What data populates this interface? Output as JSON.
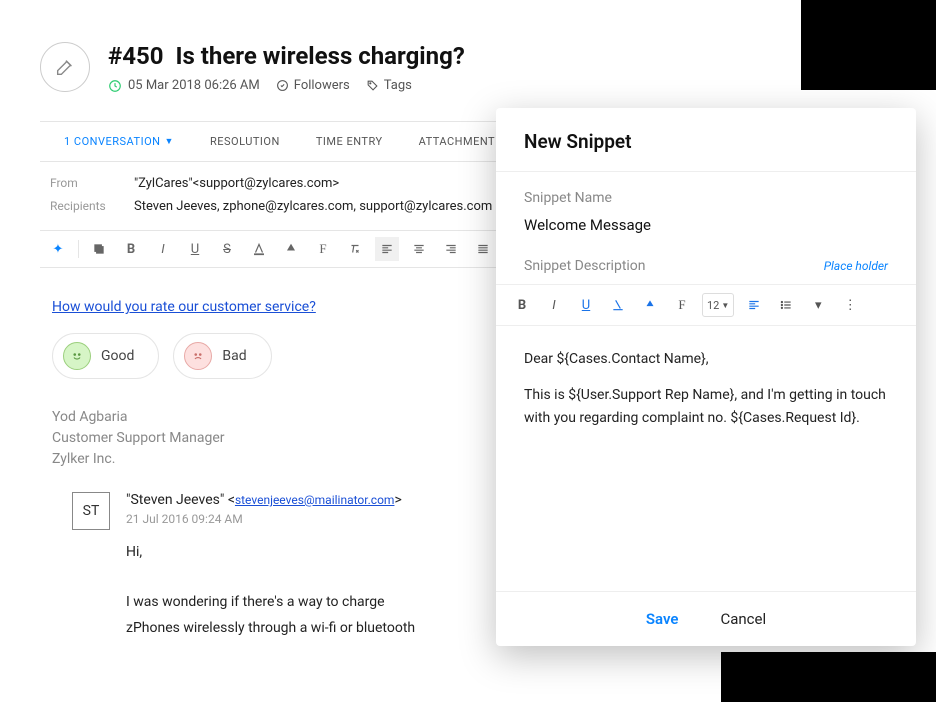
{
  "ticket": {
    "id": "#450",
    "title": "Is there wireless charging?",
    "timestamp": "05 Mar 2018 06:26 AM",
    "followers_label": "Followers",
    "tags_label": "Tags"
  },
  "tabs": {
    "conversation": "1 CONVERSATION",
    "resolution": "RESOLUTION",
    "time_entry": "TIME ENTRY",
    "attachment": "ATTACHMENT"
  },
  "fields": {
    "from_label": "From",
    "from_value": "\"ZylCares\"<support@zylcares.com>",
    "recipients_label": "Recipients",
    "recipients_value": "Steven Jeeves, zphone@zylcares.com, support@zylcares.com"
  },
  "survey": {
    "question": "How would you rate our customer service?",
    "good": "Good",
    "bad": "Bad"
  },
  "signature": {
    "name": "Yod Agbaria",
    "title": "Customer Support Manager",
    "company": "Zylker Inc."
  },
  "reply": {
    "avatar": "ST",
    "sender_name": "\"Steven Jeeves\"",
    "sender_email": "stevenjeeves@mailinator.com",
    "time": "21 Jul 2016 09:24 AM",
    "line1": "Hi,",
    "line2": "I was wondering if there's a way to charge",
    "line3": "zPhones wirelessly through a wi-fi or bluetooth"
  },
  "snippet": {
    "header": "New Snippet",
    "name_label": "Snippet Name",
    "name_value": "Welcome Message",
    "desc_label": "Snippet Description",
    "placeholder_link": "Place holder",
    "font_size": "12",
    "body_p1": "Dear ${Cases.Contact Name},",
    "body_p2": "This is ${User.Support Rep Name}, and I'm getting in touch with you regarding complaint no. ${Cases.Request Id}.",
    "save": "Save",
    "cancel": "Cancel"
  }
}
